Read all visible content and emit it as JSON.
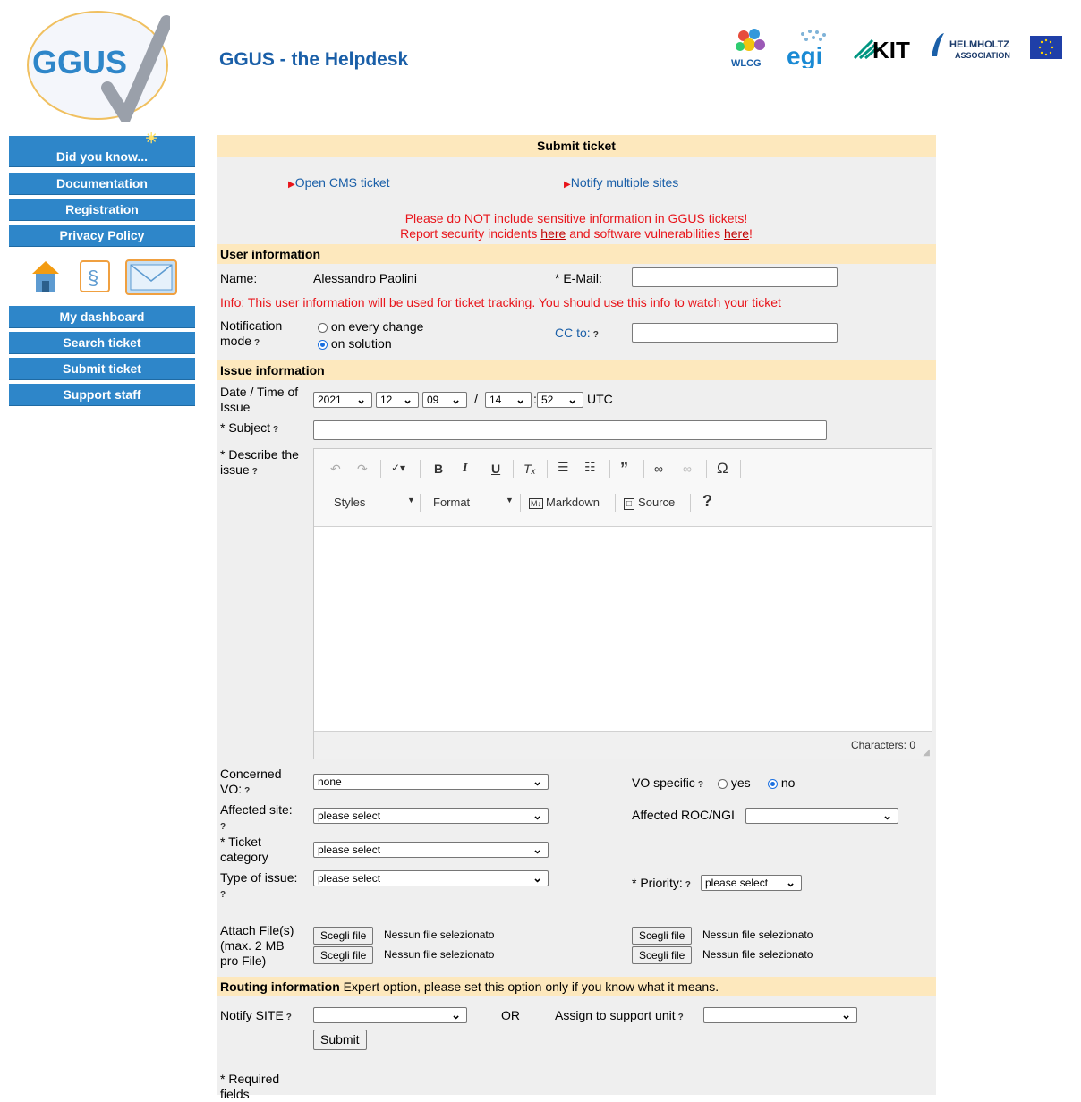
{
  "header": {
    "logo_text": "GGUS",
    "title": "GGUS - the Helpdesk",
    "partners": [
      "WLCG",
      "egi",
      "KIT",
      "HELMHOLTZ",
      "ASSOCIATION"
    ]
  },
  "sidebar": {
    "top_items": [
      "Did you know...",
      "Documentation",
      "Registration",
      "Privacy Policy"
    ],
    "bottom_items": [
      "My dashboard",
      "Search ticket",
      "Submit ticket",
      "Support staff"
    ],
    "icons": [
      "home-icon",
      "paragraph-icon",
      "mail-icon"
    ]
  },
  "panel": {
    "title": "Submit ticket",
    "links": {
      "cms": "Open CMS ticket",
      "multi": "Notify multiple sites"
    },
    "warning": {
      "line1": "Please do NOT include sensitive information in GGUS tickets!",
      "line2_a": "Report security incidents ",
      "line2_link1": "here",
      "line2_b": " and software vulnerabilities ",
      "line2_link2": "here",
      "line2_c": "!"
    },
    "user_info": {
      "heading": "User information",
      "name_label": "Name:",
      "name_value": "Alessandro Paolini",
      "email_label": "* E-Mail:",
      "email_value": "",
      "info_text": "Info: This user information will be used for ticket tracking. You should use this info to watch your ticket",
      "notification_label_1": "Notification",
      "notification_label_2": "mode",
      "opt_every_change": "on every change",
      "opt_solution": "on solution",
      "cc_label": "CC to:",
      "cc_value": ""
    },
    "issue_info": {
      "heading": "Issue information",
      "date_label_1": "Date / Time of",
      "date_label_2": "Issue",
      "year": "2021",
      "month": "12",
      "day": "09",
      "hour": "14",
      "minute": "52",
      "slash": "/",
      "colon": ":",
      "tz": "UTC",
      "subject_label": "* Subject",
      "describe_label_1": "* Describe the",
      "describe_label_2": "issue",
      "editor": {
        "styles": "Styles",
        "format": "Format",
        "markdown": "Markdown",
        "source": "Source",
        "help": "?",
        "characters": "Characters: 0"
      },
      "vo_label_1": "Concerned",
      "vo_label_2": "VO:",
      "vo_value": "none",
      "vo_specific_label": "VO specific",
      "yes": "yes",
      "no": "no",
      "site_label": "Affected site:",
      "site_value": "please select",
      "roc_label": "Affected ROC/NGI",
      "roc_value": "",
      "cat_label_1": "* Ticket",
      "cat_label_2": "category",
      "cat_value": "please select",
      "type_label": "Type of issue:",
      "type_value": "please select",
      "priority_label": "* Priority:",
      "priority_value": "please select",
      "attach_label_1": "Attach File(s)",
      "attach_label_2": "(max. 2 MB",
      "attach_label_3": "pro File)",
      "choose_file": "Scegli file",
      "no_file": "Nessun file selezionato"
    },
    "routing": {
      "heading": "Routing information",
      "note": " Expert option, please set this option only if you know what it means.",
      "notify_label": "Notify SITE",
      "notify_value": "",
      "or": "OR",
      "assign_label": "Assign to support unit",
      "assign_value": "",
      "submit": "Submit"
    },
    "required_1": "* Required",
    "required_2": "fields"
  }
}
